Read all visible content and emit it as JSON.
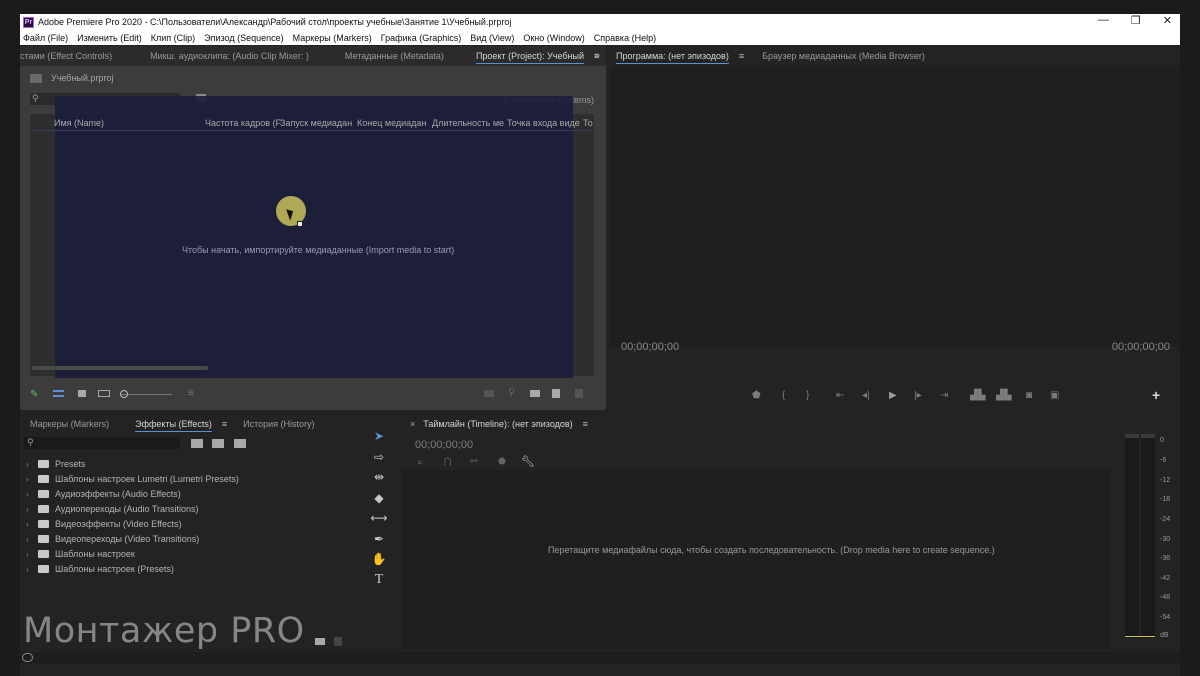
{
  "title_bar": {
    "app_title": "Adobe Premiere Pro 2020 - C:\\Пользователи\\Александр\\Рабочий стол\\проекты учебные\\Занятие 1\\Учебный.prproj",
    "logo": "Pr",
    "minimize": "—",
    "restore": "❐",
    "close": "✕"
  },
  "menu": [
    "Файл (File)",
    "Изменить (Edit)",
    "Клип (Clip)",
    "Эпизод (Sequence)",
    "Маркеры (Markers)",
    "Графика (Graphics)",
    "Вид (View)",
    "Окно (Window)",
    "Справка (Help)"
  ],
  "top_left_panel": {
    "tabs": [
      "стами (Effect Controls)",
      "Микш. аудиоклипа: (Audio Clip Mixer: )",
      "Метаданные (Metadata)",
      "Проект (Project): Учебный"
    ],
    "overflow": "»",
    "project_file": "Учебный.prproj",
    "search_placeholder": "",
    "item_count": "0 элементов (0 Items)",
    "columns": [
      "Имя (Name)",
      "Частота кадров (F",
      "Запуск медиадан",
      "Конец медиадан",
      "Длительность ме",
      "Точка входа виде",
      "То"
    ],
    "empty_message": "Чтобы начать, импортируйте медиаданные (Import media to start)"
  },
  "program_panel": {
    "tabs": [
      "Программа: (нет эпизодов)",
      "Браузер медиаданных (Media Browser)"
    ],
    "timecode_left": "00;00;00;00",
    "timecode_right": "00;00;00;00",
    "add_button": "+"
  },
  "effects_panel": {
    "tabs": [
      "Маркеры (Markers)",
      "Эффекты (Effects)",
      "История (History)"
    ],
    "tree": [
      "Presets",
      "Шаблоны настроек Lumetri (Lumetri Presets)",
      "Аудиоэффекты (Audio Effects)",
      "Аудиопереходы (Audio Transitions)",
      "Видеоэффекты (Video Effects)",
      "Видеопереходы (Video Transitions)",
      "Шаблоны настроек",
      "Шаблоны настроек (Presets)"
    ]
  },
  "timeline_panel": {
    "tab": "Таймлайн (Timeline): (нет эпизодов)",
    "close": "×",
    "timecode": "00;00;00;00",
    "empty_message": "Перетащите медиафайлы сюда, чтобы создать последовательность. (Drop media here to create sequence.)"
  },
  "audio_meter": {
    "labels": [
      "0",
      "-6",
      "-12",
      "-18",
      "-24",
      "-30",
      "-36",
      "-42",
      "-48",
      "-54",
      "dB"
    ]
  },
  "watermark": "Монтажер PRO",
  "colors": {
    "accent_blue": "#5c8fd6",
    "project_overlay": "#1c1e3c",
    "cursor_highlight": "#c9c25a"
  }
}
